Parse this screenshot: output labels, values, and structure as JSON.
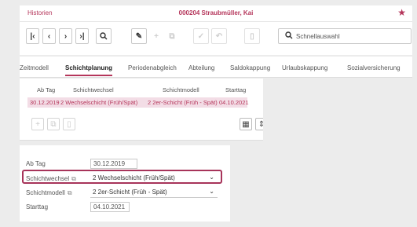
{
  "title": {
    "left": "Historien",
    "center": "000204  Straubmüller, Kai",
    "star_icon": "star-icon"
  },
  "toolbar": {
    "first": "|‹",
    "prev": "‹",
    "next": "›",
    "last": "›|",
    "search_icon": "🔍",
    "edit_icon": "✎",
    "add_icon": "+",
    "copy_icon": "⧉",
    "check_icon": "✓",
    "undo_icon": "↶",
    "delete_icon": "🗑",
    "quicksearch_placeholder": "Schnellauswahl"
  },
  "tabs": [
    "Zeitmodell",
    "Schichtplanung",
    "Periodenabgleich",
    "Abteilung",
    "Saldokappung",
    "Urlaubskappung",
    "Sozialversicherung"
  ],
  "grid": {
    "headers": [
      "Ab Tag",
      "Schichtwechsel",
      "Schichtmodell",
      "Starttag"
    ],
    "row": [
      "30.12.2019",
      "2 Wechselschicht (Früh/Spät)",
      "2 2er-Schicht (Früh - Spät)",
      "04.10.2021"
    ]
  },
  "form": {
    "ab_tag_label": "Ab Tag",
    "ab_tag_value": "30.12.2019",
    "schichtwechsel_label": "Schichtwechsel",
    "schichtwechsel_value": "2 Wechselschicht (Früh/Spät)",
    "schichtmodell_label": "Schichtmodell",
    "schichtmodell_value": "2 2er-Schicht (Früh - Spät)",
    "starttag_label": "Starttag",
    "starttag_value": "04.10.2021"
  },
  "colors": {
    "accent": "#b5365b",
    "selected_row": "#f3dde6"
  }
}
